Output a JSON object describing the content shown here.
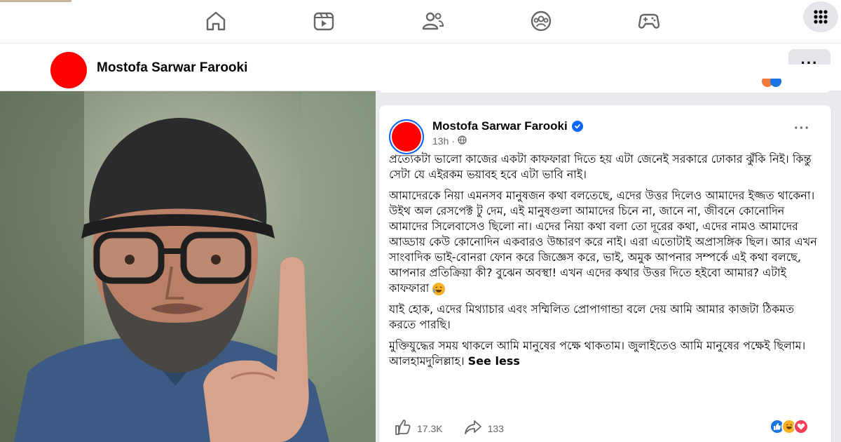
{
  "nav": {
    "icons": [
      "home-icon",
      "video-icon",
      "friends-icon",
      "groups-icon",
      "gaming-icon",
      "menu-grid-icon"
    ]
  },
  "header": {
    "name": "Mostofa Sarwar Farooki",
    "more": "···"
  },
  "post": {
    "author": "Mostofa Sarwar Farooki",
    "time": "13h",
    "time_separator": "·",
    "more": "···",
    "paragraphs": [
      "প্রত্যেকটা ভালো কাজের একটা কাফফারা দিতে হয় এটা জেনেই সরকারে ঢোকার ঝুঁকি নিই। কিন্তু সেটা যে এইরকম ভয়াবহ হবে এটা ভাবি নাই।",
      "আমাদেরকে নিয়া এমনসব মানুষজন কথা বলতেছে, এদের উত্তর দিলেও আমাদের ইজ্জত থাকেনা। উইথ অল রেসপেক্ট টু দেম, এই মানুষগুলা আমাদের চিনে না, জানে না, জীবনে কোনোদিন আমাদের সিলেবাসেও ছিলো না। এদের নিয়া কথা বলা তো দূরের কথা, এদের নামও আমাদের আড্ডায় কেউ কোনোদিন একবারও উচ্চারণ করে নাই। এরা এতোটাই অপ্রাসঙ্গিক ছিল। আর এখন সাংবাদিক ভাই-বোনরা ফোন করে জিজ্ঞেস করে, ভাই, অমুক আপনার সম্পর্কে এই কথা বলছে, আপনার প্রতিক্রিয়া কী? বুঝেন অবস্থা! এখন এদের কথার উত্তর দিতে হইবো আমার? এটাই কাফফারা",
      "যাই হোক, এদের মিথ্যাচার এবং সম্মিলিত প্রোপাগান্ডা বলে দেয় আমি আমার কাজটা ঠিকমত করতে পারছি।",
      "মুক্তিযুদ্ধের সময় থাকলে আমি মানুষের পক্ষে থাকতাম। জুলাইতেও আমি মানুষের পক্ষেই ছিলাম। আলহামদুলিল্লাহ।"
    ],
    "see_less": "See less",
    "likes": "17.3K",
    "shares": "133",
    "reaction_icons": [
      "like-reaction-icon",
      "haha-reaction-icon",
      "love-reaction-icon"
    ]
  },
  "colors": {
    "avatar": "#fe0000",
    "accent_blue": "#0866ff",
    "muted": "#65676b",
    "bg": "#e9ebee"
  }
}
